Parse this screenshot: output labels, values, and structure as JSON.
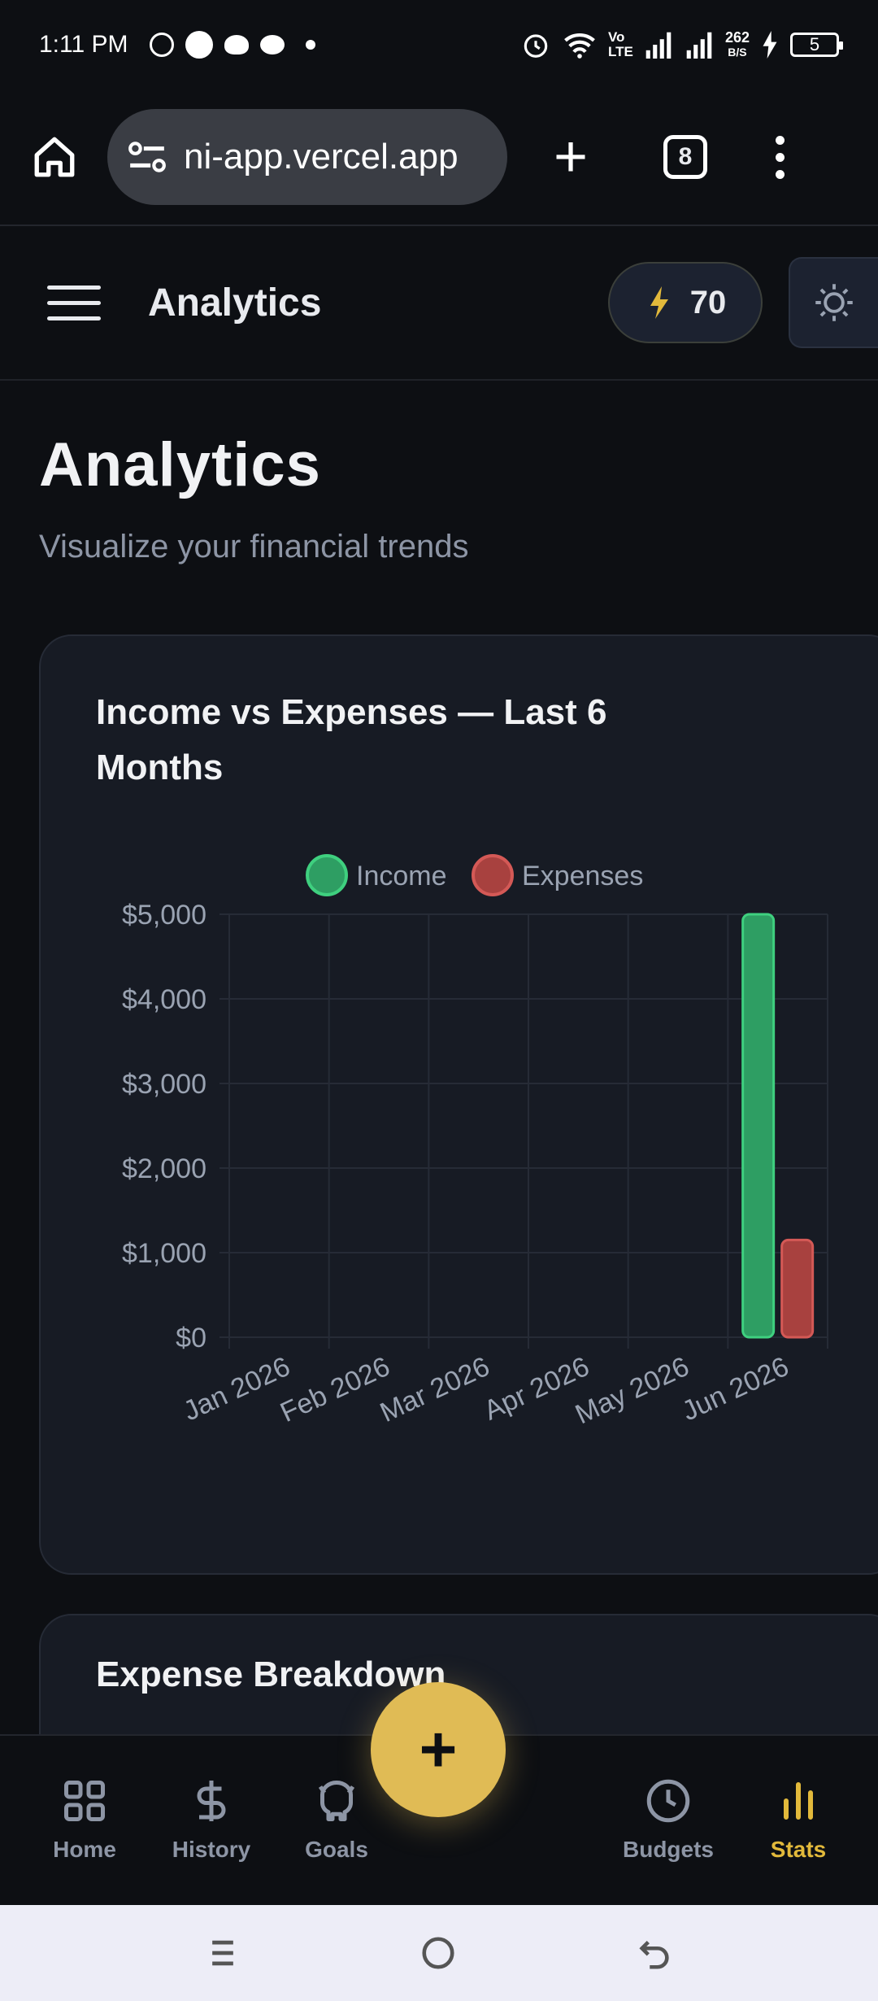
{
  "status_bar": {
    "time": "1:11 PM",
    "speed": "262",
    "speed_unit": "B/S",
    "volte": "Vo LTE",
    "battery": "5"
  },
  "browser": {
    "url": "ni-app.vercel.app",
    "tab_count": "8"
  },
  "header": {
    "title": "Analytics",
    "points": "70"
  },
  "page": {
    "title": "Analytics",
    "subtitle": "Visualize your financial trends"
  },
  "income_card": {
    "title": "Income vs Expenses — Last 6 Months"
  },
  "breakdown_card": {
    "title": "Expense Breakdown"
  },
  "chart_data": {
    "type": "bar",
    "title": "Income vs Expenses — Last 6 Months",
    "categories": [
      "Jan 2026",
      "Feb 2026",
      "Mar 2026",
      "Apr 2026",
      "May 2026",
      "Jun 2026"
    ],
    "series": [
      {
        "name": "Income",
        "values": [
          0,
          0,
          0,
          0,
          0,
          5000
        ],
        "color": "#2e9e63"
      },
      {
        "name": "Expenses",
        "values": [
          0,
          0,
          0,
          0,
          0,
          1150
        ],
        "color": "#a8413f"
      }
    ],
    "yticks": [
      "$0",
      "$1,000",
      "$2,000",
      "$3,000",
      "$4,000",
      "$5,000"
    ],
    "ylim": [
      0,
      5000
    ],
    "grid": true,
    "legend": "top-center"
  },
  "nav": {
    "items": [
      {
        "label": "Home",
        "icon": "grid-icon"
      },
      {
        "label": "History",
        "icon": "dollar-icon"
      },
      {
        "label": "Goals",
        "icon": "piggy-bank-icon"
      },
      {
        "label": "Budgets",
        "icon": "clock-icon"
      },
      {
        "label": "Stats",
        "icon": "bar-chart-icon"
      }
    ],
    "fab_label": "+",
    "active_color": "#e2b93b"
  }
}
